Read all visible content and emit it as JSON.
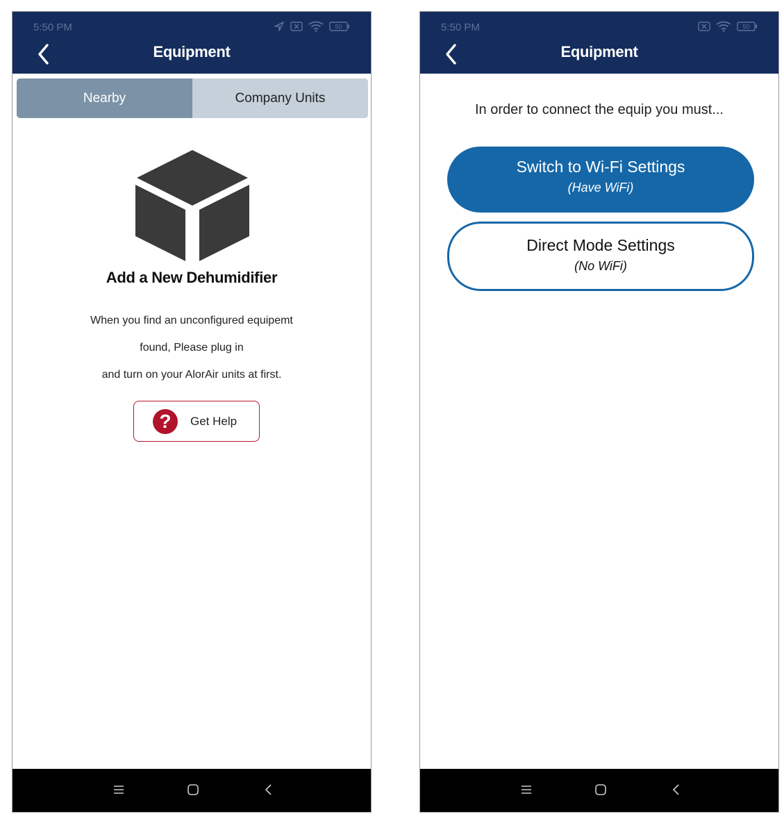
{
  "status_bar": {
    "time": "5:50 PM",
    "battery": "50"
  },
  "left_screen": {
    "title": "Equipment",
    "tabs": [
      {
        "label": "Nearby",
        "active": true
      },
      {
        "label": "Company Units",
        "active": false
      }
    ],
    "heading": "Add a New Dehumidifier",
    "message_lines": [
      "When you find an unconfigured equipemt",
      "found, Please plug in",
      "and turn on your AlorAir units at first."
    ],
    "help_label": "Get Help",
    "help_icon_glyph": "?"
  },
  "right_screen": {
    "title": "Equipment",
    "instruction": "In order to connect the equip you must...",
    "wifi_option": {
      "title": "Switch to Wi-Fi Settings",
      "subtitle": "(Have WiFi)"
    },
    "direct_option": {
      "title": "Direct Mode Settings",
      "subtitle": "(No WiFi)"
    }
  },
  "colors": {
    "app_bar": "#142d5c",
    "tab_active": "#7b92a7",
    "tab_inactive": "#c5d0da",
    "primary_button": "#1567a8",
    "help_accent": "#b0132b"
  },
  "icons": [
    "back-chevron-icon",
    "location-arrow-icon",
    "sim-x-icon",
    "wifi-icon",
    "battery-icon",
    "box-icon",
    "help-icon",
    "menu-icon",
    "home-icon",
    "nav-back-icon"
  ]
}
